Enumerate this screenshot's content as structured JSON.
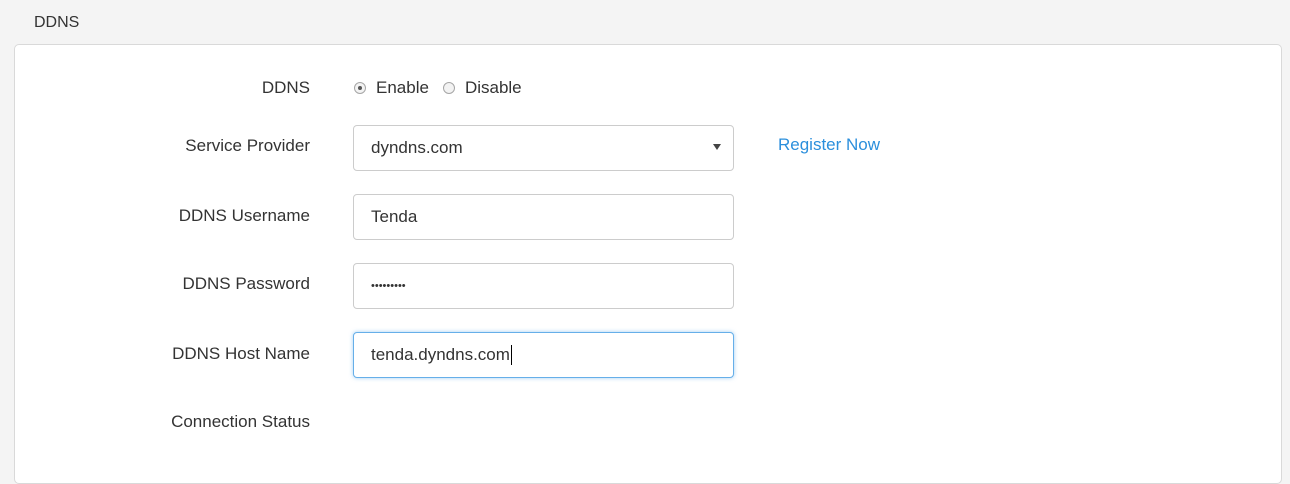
{
  "section": {
    "title": "DDNS"
  },
  "ddns": {
    "label": "DDNS",
    "options": [
      "Enable",
      "Disable"
    ],
    "selected": "Enable"
  },
  "service_provider": {
    "label": "Service Provider",
    "value": "dyndns.com",
    "register_link": "Register Now"
  },
  "username": {
    "label": "DDNS Username",
    "value": "Tenda"
  },
  "password": {
    "label": "DDNS Password",
    "masked_value": "•••••••••"
  },
  "host_name": {
    "label": "DDNS Host Name",
    "value": "tenda.dyndns.com"
  },
  "connection_status": {
    "label": "Connection Status"
  },
  "colors": {
    "link": "#2b8fdc",
    "focus_border": "#66afe9",
    "panel_bg": "#ffffff",
    "page_bg": "#f4f4f4"
  }
}
